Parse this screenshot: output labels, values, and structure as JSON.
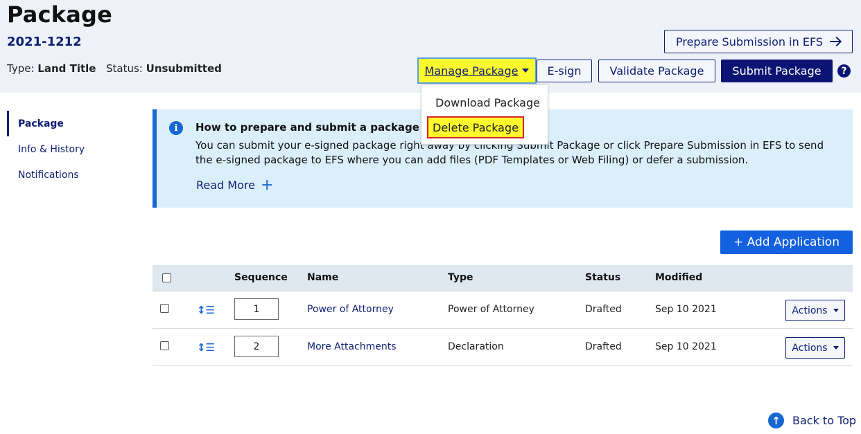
{
  "header": {
    "title": "Package",
    "package_number": "2021-1212",
    "type_label": "Type:",
    "type_value": "Land Title",
    "status_label": "Status:",
    "status_value": "Unsubmitted",
    "prepare_button": "Prepare Submission in EFS",
    "manage_button": "Manage Package",
    "esign_button": "E-sign",
    "validate_button": "Validate Package",
    "submit_button": "Submit Package",
    "help_icon": "?"
  },
  "manage_dropdown": {
    "items": [
      "Download Package",
      "Delete Package"
    ]
  },
  "sidebar": {
    "items": [
      {
        "label": "Package",
        "active": true
      },
      {
        "label": "Info & History",
        "active": false
      },
      {
        "label": "Notifications",
        "active": false
      }
    ]
  },
  "info_box": {
    "icon": "i",
    "title": "How to prepare and submit a package",
    "text": "You can submit your e-signed package right away by clicking Submit Package or click Prepare Submission in EFS to send the e-signed package to EFS where you can add files (PDF Templates or Web Filing) or defer a submission.",
    "read_more": "Read More",
    "read_more_icon": "+"
  },
  "add_application_button": "+ Add Application",
  "table": {
    "columns": [
      "Sequence",
      "Name",
      "Type",
      "Status",
      "Modified"
    ],
    "rows": [
      {
        "sequence": "1",
        "name": "Power of Attorney",
        "type": "Power of Attorney",
        "status": "Drafted",
        "modified": "Sep 10 2021",
        "actions": "Actions"
      },
      {
        "sequence": "2",
        "name": "More Attachments",
        "type": "Declaration",
        "status": "Drafted",
        "modified": "Sep 10 2021",
        "actions": "Actions"
      }
    ]
  },
  "back_to_top": "Back to Top",
  "colors": {
    "navy": "#0c1f73",
    "primary_blue": "#1360e0",
    "info_bg": "#dbeffb",
    "header_bg": "#eef2f8",
    "highlight_yellow": "#fcf92d",
    "delete_border_red": "#d9242b"
  }
}
